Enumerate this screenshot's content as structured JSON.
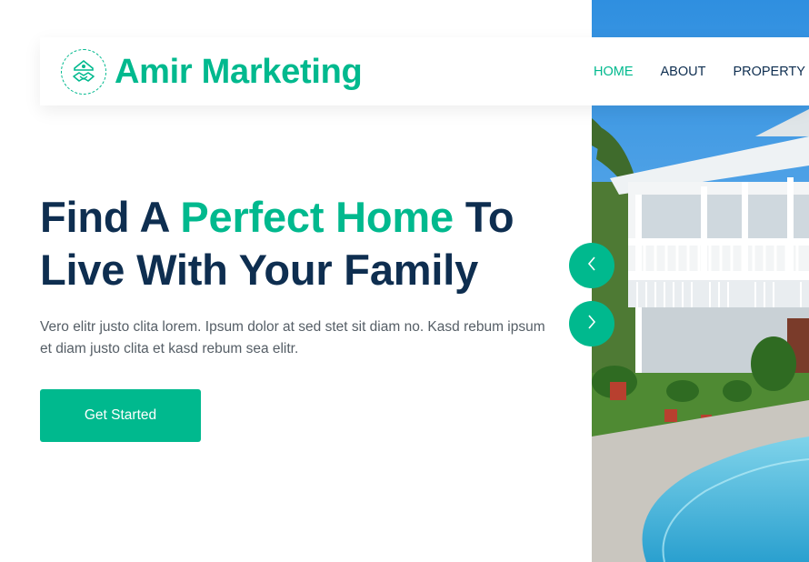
{
  "brand": {
    "name": "Amir Marketing",
    "logo_icon": "handshake-house-icon",
    "color": "#00b98e"
  },
  "nav": {
    "items": [
      {
        "label": "HOME",
        "active": true
      },
      {
        "label": "ABOUT",
        "active": false
      },
      {
        "label": "PROPERTY",
        "active": false,
        "icon": "chevron-down-icon"
      }
    ]
  },
  "hero": {
    "title_part1": "Find A ",
    "title_accent": "Perfect Home",
    "title_part2": " To Live With Your Family",
    "text": "Vero elitr justo clita lorem. Ipsum dolor at sed stet sit diam no. Kasd rebum ipsum et diam justo clita et kasd rebum sea elitr.",
    "cta_label": "Get Started"
  },
  "carousel": {
    "prev_icon": "chevron-left-icon",
    "next_icon": "chevron-right-icon"
  },
  "colors": {
    "accent": "#00b98e",
    "heading": "#0e2e50",
    "body_text": "#555e66"
  }
}
